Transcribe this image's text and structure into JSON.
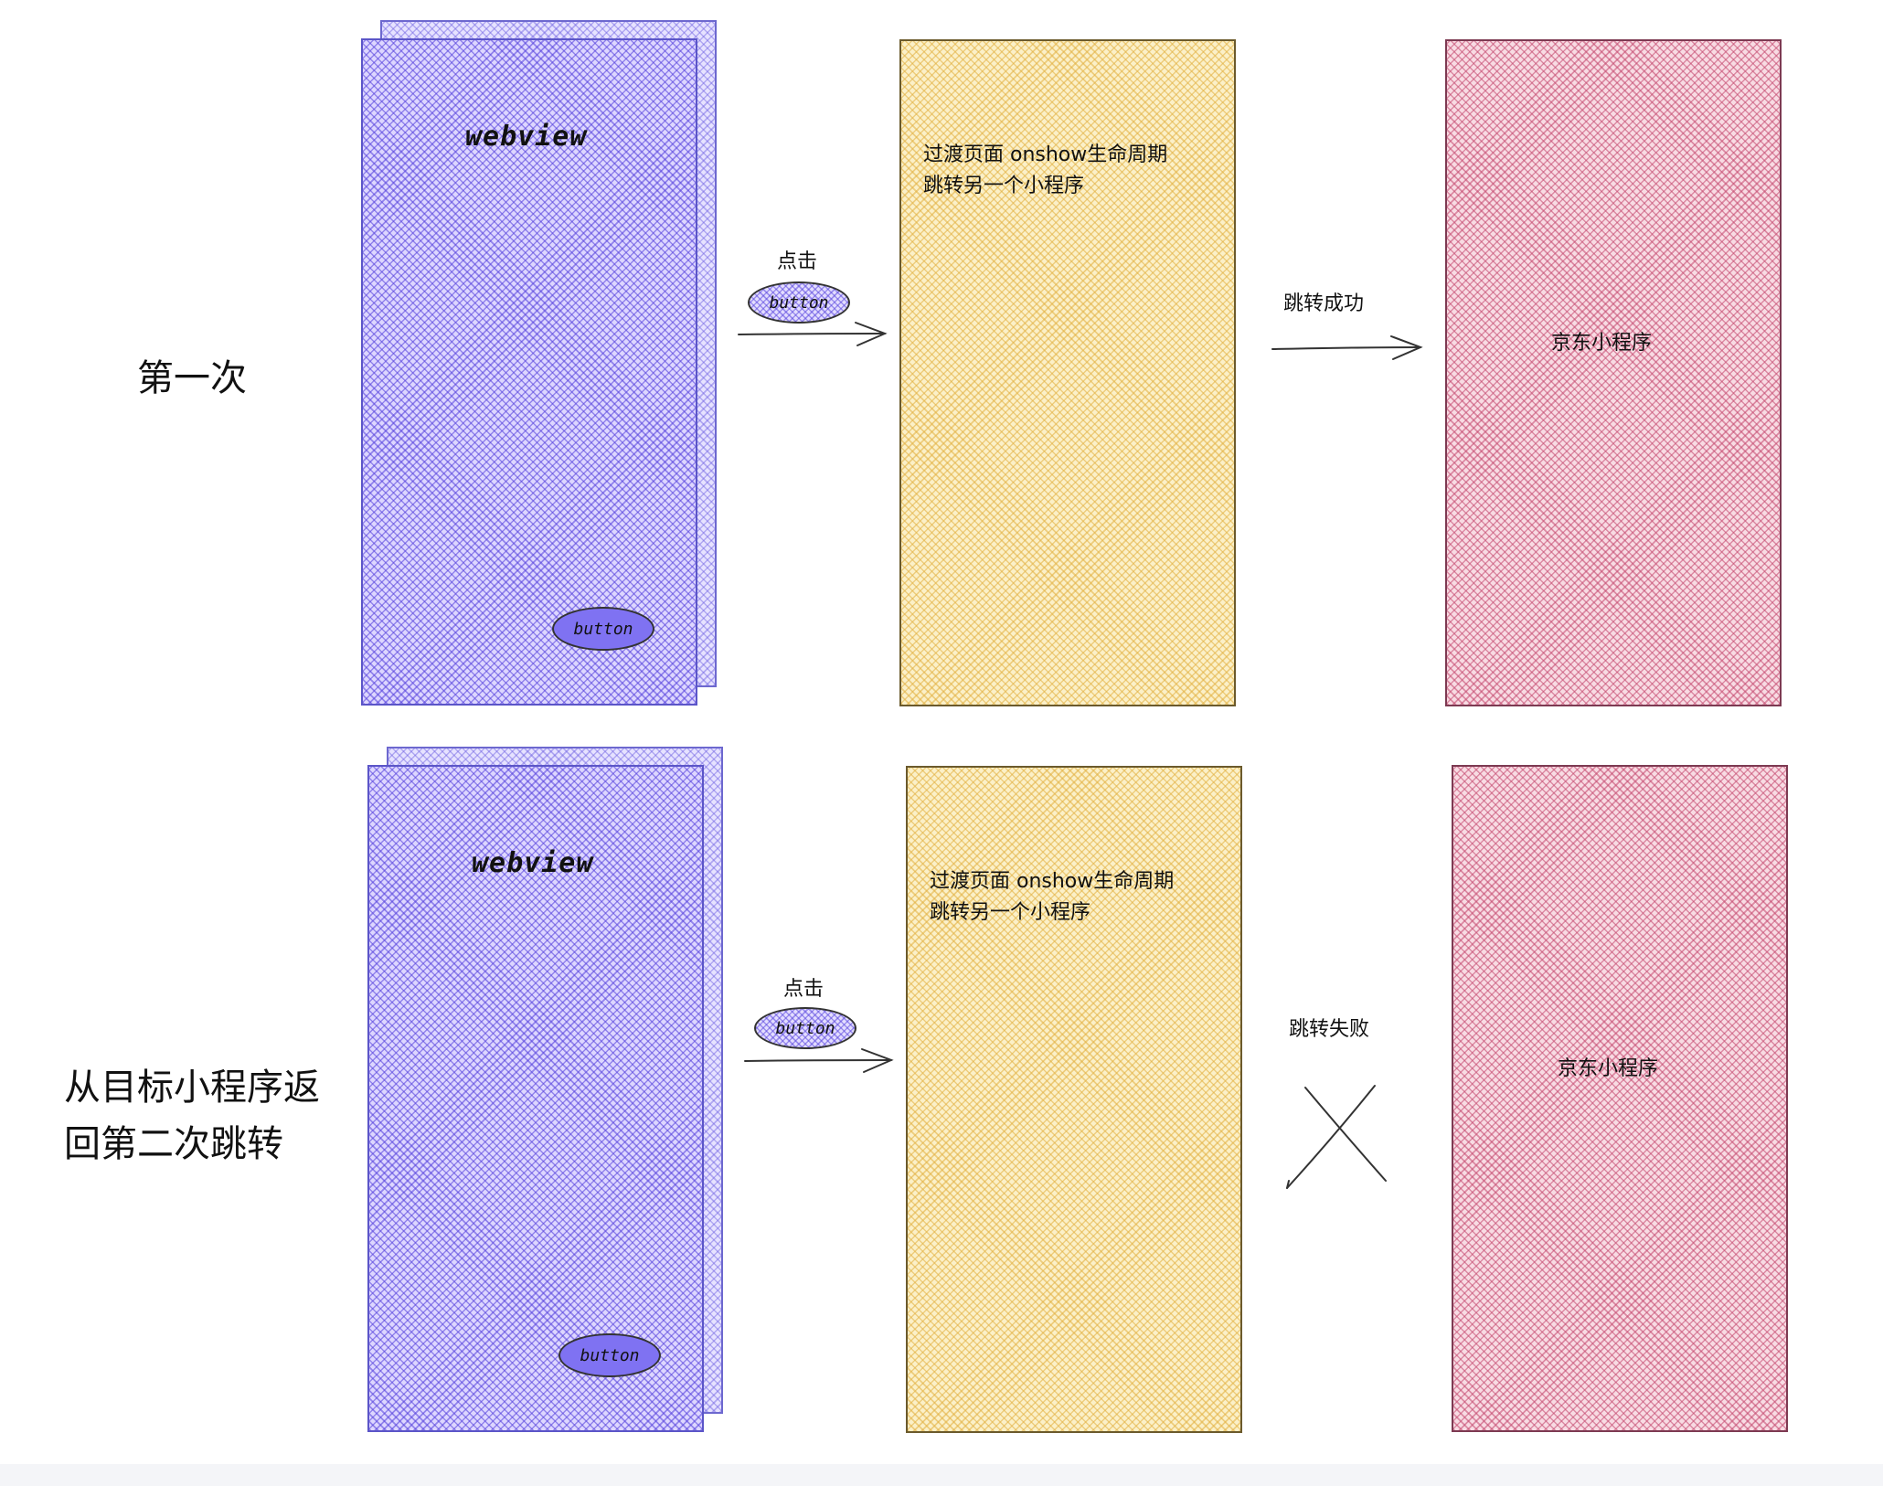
{
  "rows": [
    {
      "label": "第一次",
      "webview_label": "webview",
      "inner_button_label": "button",
      "click_caption": "点击",
      "click_button_label": "button",
      "transition_text_line1": "过渡页面 onshow生命周期",
      "transition_text_line2": "跳转另一个小程序",
      "result_caption": "跳转成功",
      "target_label": "京东小程序"
    },
    {
      "label_line1": "从目标小程序返",
      "label_line2": "回第二次跳转",
      "webview_label": "webview",
      "inner_button_label": "button",
      "click_caption": "点击",
      "click_button_label": "button",
      "transition_text_line1": "过渡页面 onshow生命周期",
      "transition_text_line2": "跳转另一个小程序",
      "result_caption": "跳转失败",
      "target_label": "京东小程序"
    }
  ],
  "colors": {
    "webview_fill": "#ddd6ff",
    "webview_stroke": "#5b55c8",
    "button_fill": "#7f72f2",
    "transition_fill": "#fbf0c8",
    "target_fill": "#f8dbe3"
  },
  "icons": {
    "arrow": "arrow-right-icon",
    "fail": "x-cross-icon"
  }
}
